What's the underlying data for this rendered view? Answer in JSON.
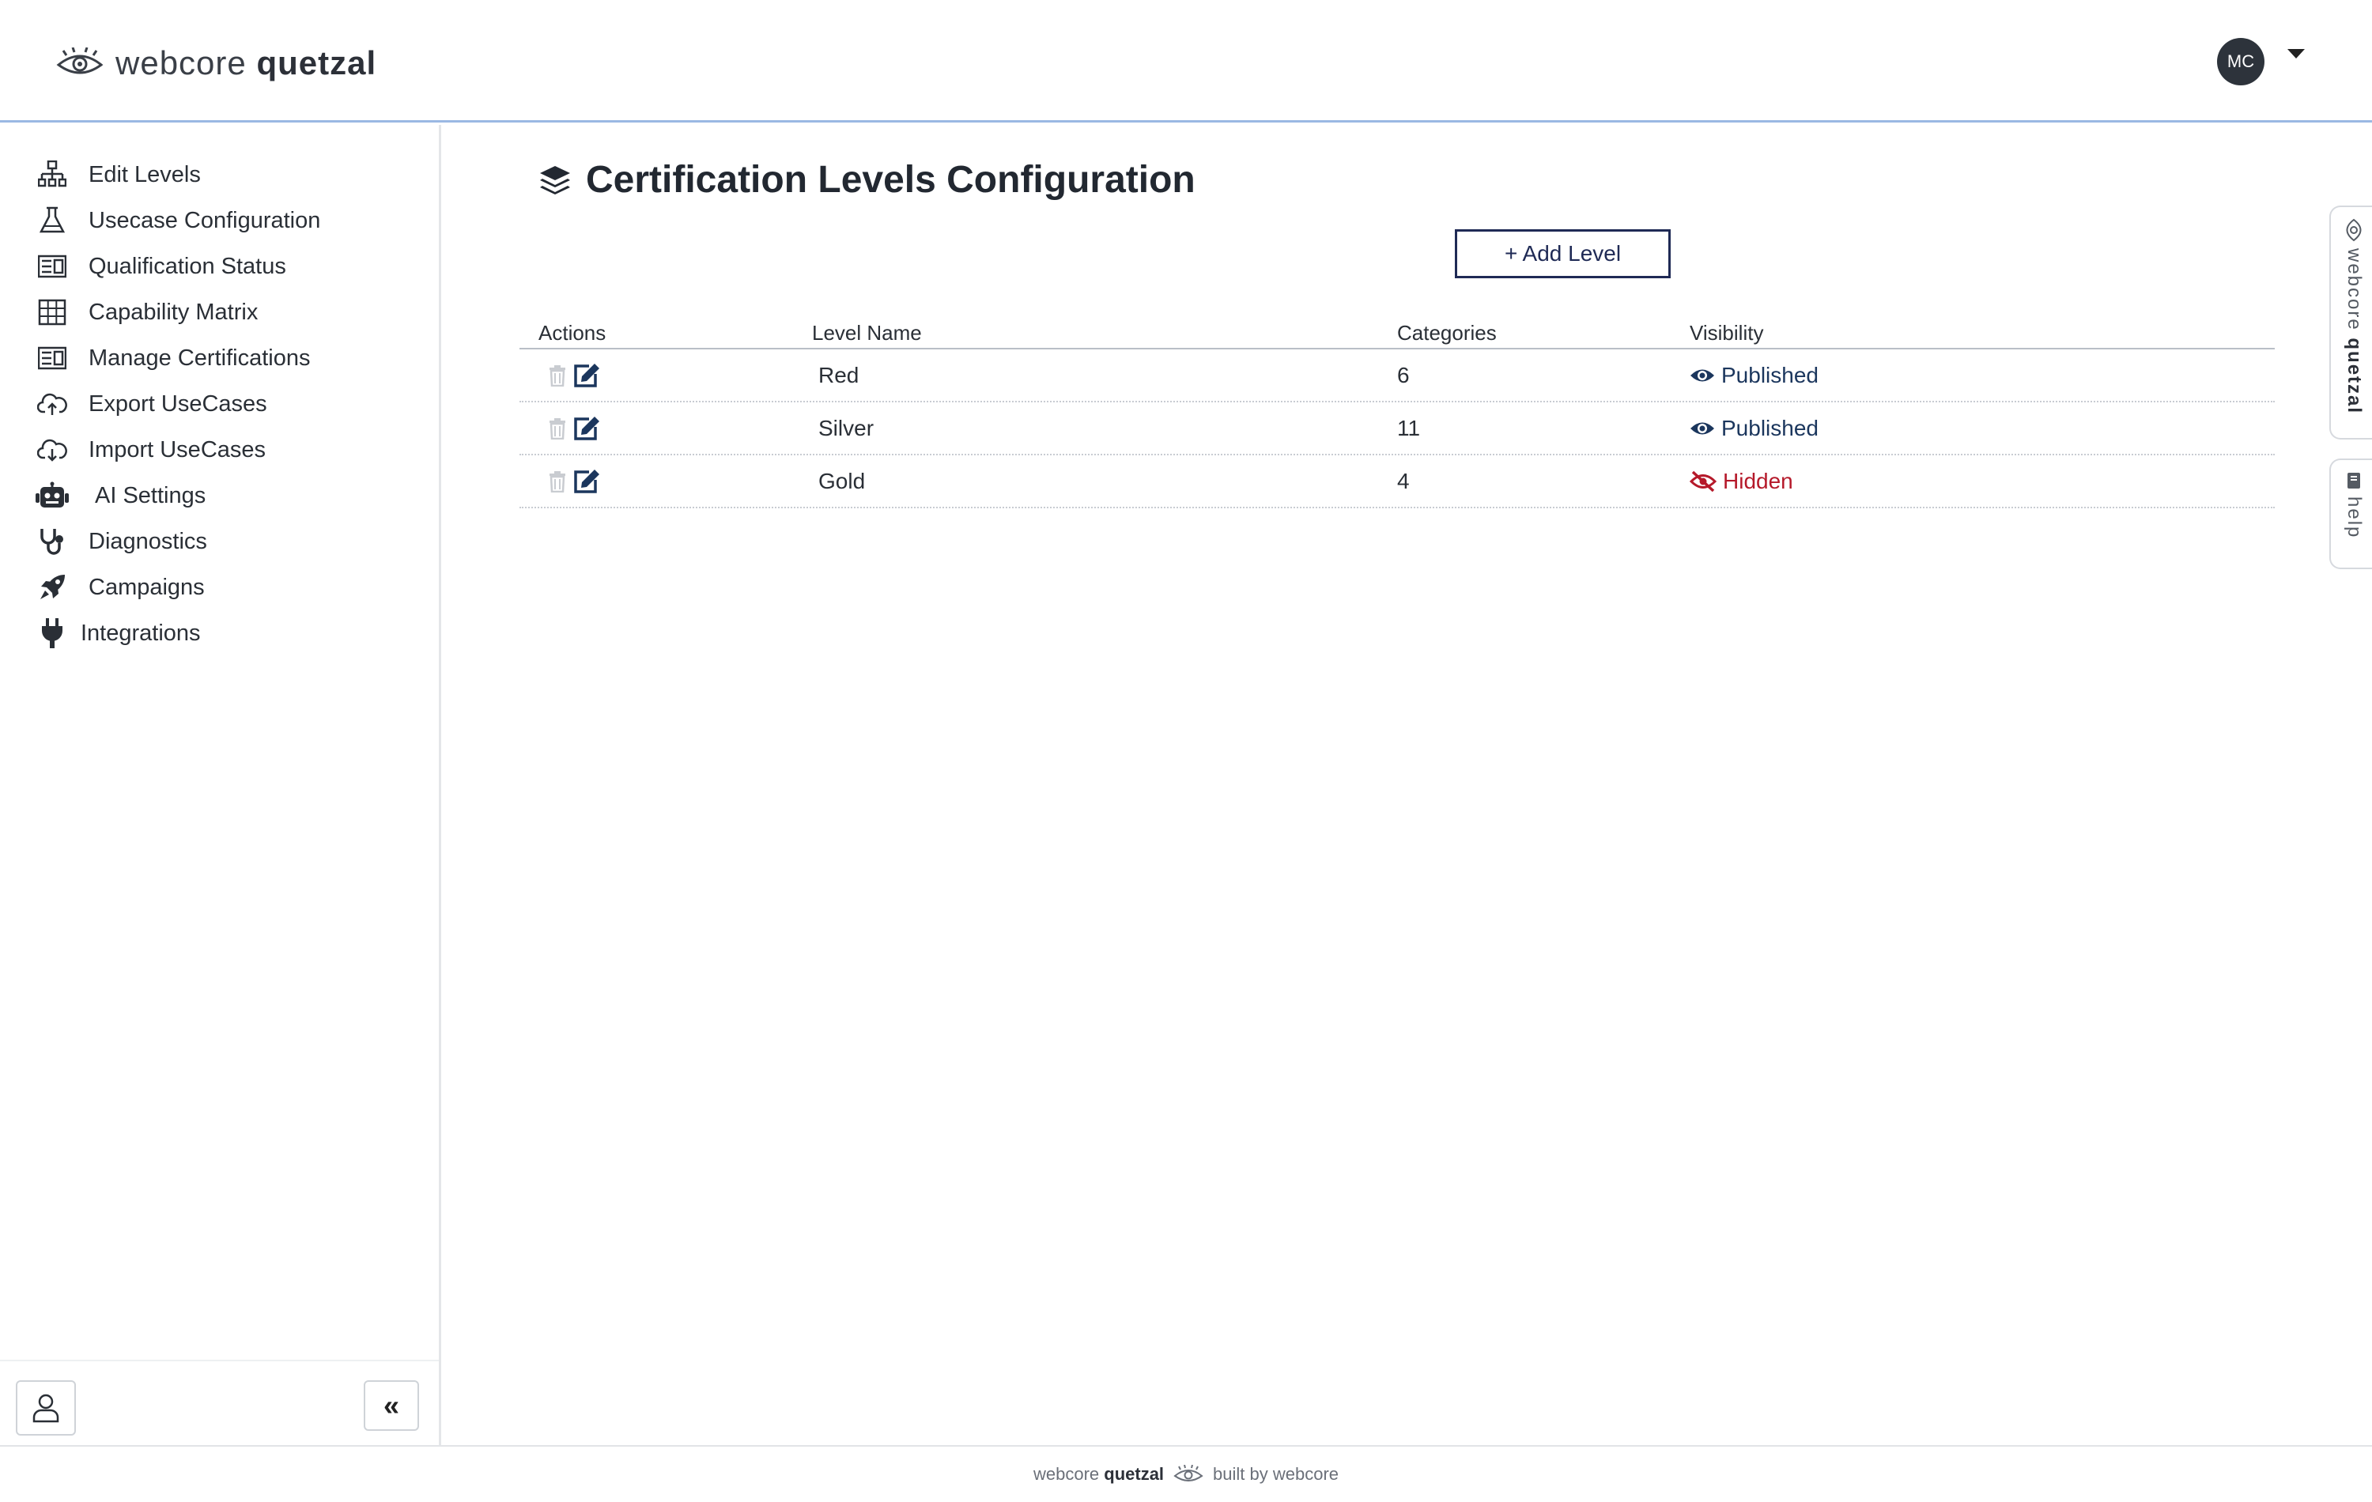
{
  "header": {
    "brand_light": "webcore",
    "brand_bold": "quetzal",
    "avatar_initials": "MC"
  },
  "sidebar": {
    "items": [
      {
        "label": "Edit Levels",
        "icon": "sitemap-icon"
      },
      {
        "label": "Usecase Configuration",
        "icon": "flask-icon"
      },
      {
        "label": "Qualification Status",
        "icon": "list-card-icon"
      },
      {
        "label": "Capability Matrix",
        "icon": "grid-icon"
      },
      {
        "label": "Manage Certifications",
        "icon": "list-card-icon"
      },
      {
        "label": "Export UseCases",
        "icon": "cloud-upload-icon"
      },
      {
        "label": "Import UseCases",
        "icon": "cloud-download-icon"
      },
      {
        "label": "AI Settings",
        "icon": "robot-icon"
      },
      {
        "label": "Diagnostics",
        "icon": "stethoscope-icon"
      },
      {
        "label": "Campaigns",
        "icon": "rocket-icon"
      },
      {
        "label": "Integrations",
        "icon": "plug-icon"
      }
    ],
    "collapse_label": "«"
  },
  "main": {
    "title": "Certification Levels Configuration",
    "add_button": "+ Add Level",
    "table": {
      "columns": [
        "Actions",
        "Level Name",
        "Categories",
        "Visibility"
      ],
      "rows": [
        {
          "name": "Red",
          "categories": "6",
          "visibility": "Published"
        },
        {
          "name": "Silver",
          "categories": "11",
          "visibility": "Published"
        },
        {
          "name": "Gold",
          "categories": "4",
          "visibility": "Hidden"
        }
      ]
    }
  },
  "side_tabs": {
    "brand_light": "webcore",
    "brand_bold": "quetzal",
    "help": "help"
  },
  "footer": {
    "brand_light": "webcore",
    "brand_bold": "quetzal",
    "built_by": "built by webcore"
  },
  "colors": {
    "accent_navy": "#1f2a55",
    "published": "#1b365d",
    "hidden": "#b5192a",
    "header_border": "#9bb8e3"
  }
}
